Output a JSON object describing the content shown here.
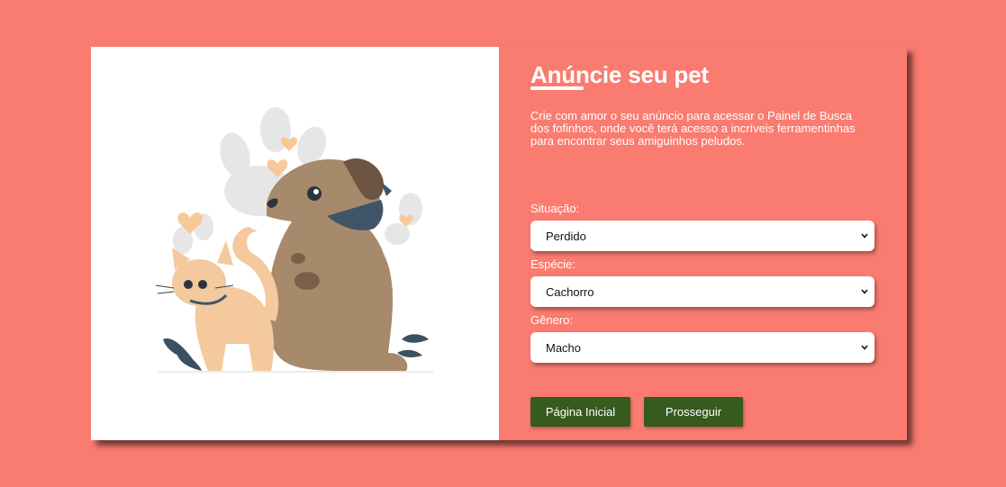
{
  "page": {
    "background": "#fa7b70",
    "title": "Anúncie seu pet",
    "description": "Crie com amor o seu anúncio para acessar o Painel de Busca dos fofinhos, onde você terá acesso a incríveis ferramentinhas para encontrar seus amiguinhos peludos."
  },
  "illustration": {
    "name": "dog-and-cat-illustration"
  },
  "form": {
    "situacao": {
      "label": "Situação:",
      "value": "Perdido"
    },
    "especie": {
      "label": "Espécie:",
      "value": "Cachorro"
    },
    "genero": {
      "label": "Gênero:",
      "value": "Macho"
    }
  },
  "buttons": {
    "home_label": "Página Inicial",
    "proceed_label": "Prosseguir",
    "color": "#375a1f"
  }
}
